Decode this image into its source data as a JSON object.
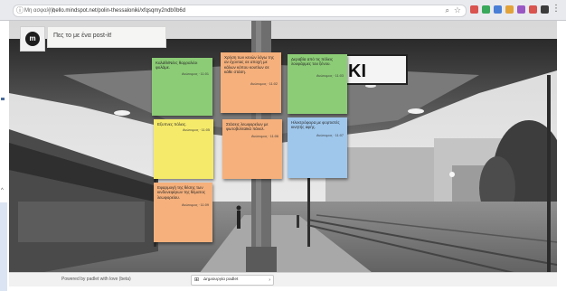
{
  "browser": {
    "site_label": "Μη ασφαλής",
    "url": "hello.mindspot.net/polin-thessaloniki/xfqsqmy2ndb0b6d",
    "extension_colors": [
      "#d9534f",
      "#3aa85a",
      "#4a7fd6",
      "#e2a23a",
      "#9a57c4",
      "#d9534f",
      "#3c3c3c"
    ]
  },
  "board": {
    "title": "Πες το με ένα post-it!"
  },
  "notes": [
    {
      "text": "Καλάθι/Νέες θαρραλέοι φυλάμε.",
      "author": "Ανώνυμος · 11:01"
    },
    {
      "text": "Χρήση των κενών λόγω της αν έχοντας σε αποχή με κάλων κόπου κουτίων σε κάθε στάση.",
      "author": "Ανώνυμος · 11:02"
    },
    {
      "text": "Δεραβία από τις πόλεις λουφάρμες του ξένου.",
      "author": "Ανώνυμος · 11:03"
    },
    {
      "text": "Εξυπνες πόλεις.",
      "author": "Ανώνυμος · 11:05"
    },
    {
      "text": "Στάσεις λεωφορείων με φωτοβολταϊκά πάνελ.",
      "author": "Ανώνυμος · 11:06"
    },
    {
      "text": "Ηλεκτρόφορα με φορτιστές κινητής αφής.",
      "author": "Ανώνυμος · 11:07"
    },
    {
      "text": "Εφαρμογή της θέσης των κινδυνεφέρων της θέματος λεωφορείου.",
      "author": "Ανώνυμος · 11:09"
    }
  ],
  "footer": {
    "link": "Powered by padlet with love (beta)",
    "button_label": "Δημιουργία padlet"
  }
}
